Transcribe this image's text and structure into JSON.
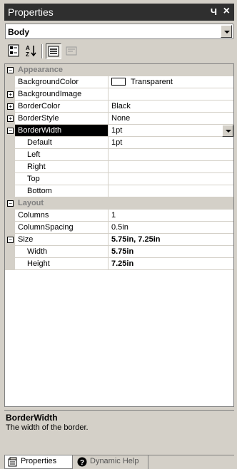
{
  "window": {
    "title": "Properties"
  },
  "object_selector": {
    "value": "Body"
  },
  "grid": {
    "rows": [
      {
        "type": "category",
        "label": "Appearance",
        "expander": "−"
      },
      {
        "label": "BackgroundColor",
        "value": "Transparent"
      },
      {
        "label": "BackgroundImage",
        "value": "",
        "expander": "+"
      },
      {
        "label": "BorderColor",
        "value": "Black",
        "expander": "+"
      },
      {
        "label": "BorderStyle",
        "value": "None",
        "expander": "+"
      },
      {
        "label": "BorderWidth",
        "value": "1pt",
        "expander": "−"
      },
      {
        "label": "Default",
        "value": "1pt"
      },
      {
        "label": "Left",
        "value": ""
      },
      {
        "label": "Right",
        "value": ""
      },
      {
        "label": "Top",
        "value": ""
      },
      {
        "label": "Bottom",
        "value": ""
      },
      {
        "type": "category",
        "label": "Layout",
        "expander": "−"
      },
      {
        "label": "Columns",
        "value": "1"
      },
      {
        "label": "ColumnSpacing",
        "value": "0.5in"
      },
      {
        "label": "Size",
        "value": "5.75in, 7.25in",
        "expander": "−"
      },
      {
        "label": "Width",
        "value": "5.75in"
      },
      {
        "label": "Height",
        "value": "7.25in"
      }
    ]
  },
  "description": {
    "title": "BorderWidth",
    "text": "The width of the border."
  },
  "tabs": [
    {
      "label": "Properties",
      "icon": "properties-tab-icon"
    },
    {
      "label": "Dynamic Help",
      "icon": "help-icon"
    }
  ]
}
